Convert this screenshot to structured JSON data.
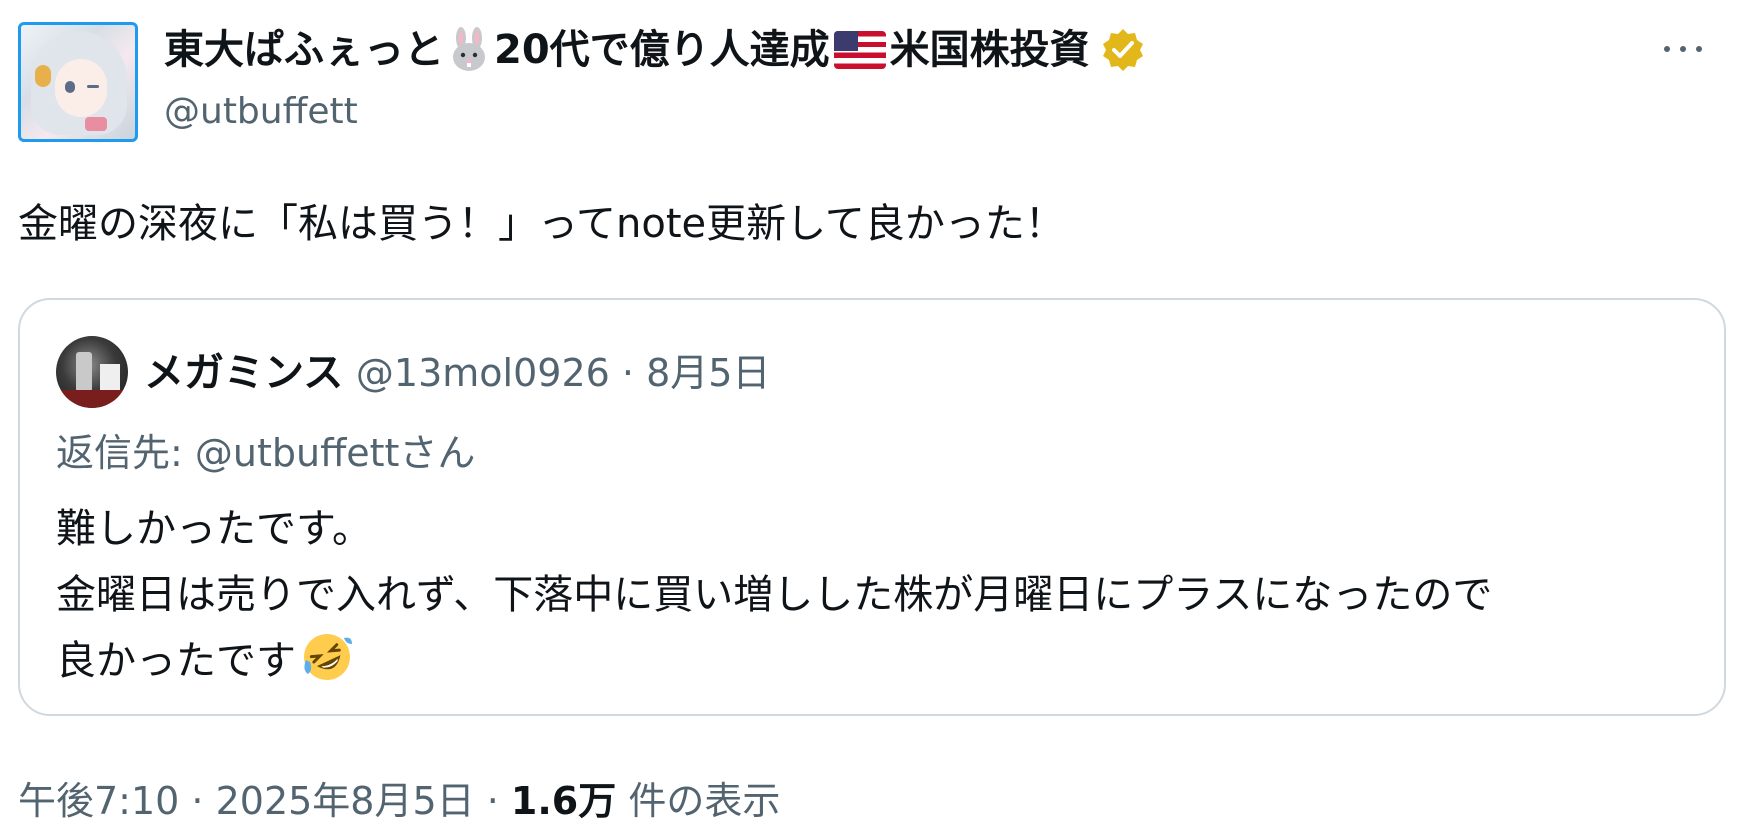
{
  "author": {
    "name_part1": "東大ぱふぇっと",
    "name_part2": "20代で億り人達成",
    "name_part3": "米国株投資",
    "name_icons": [
      "rabbit-icon",
      "us-flag-icon"
    ],
    "verified_icon": "verified-badge-icon",
    "handle": "@utbuffett"
  },
  "menu": {
    "icon": "more-icon"
  },
  "tweet": {
    "text": "金曜の深夜に「私は買う！」ってnote更新して良かった！"
  },
  "quote": {
    "name": "メガミンス",
    "handle": "@13mol0926",
    "separator": " · ",
    "date": "8月5日",
    "reply_to": "返信先: @utbuffettさん",
    "body_line1": "難しかったです。",
    "body_line2": "金曜日は売りで入れず、下落中に買い増しした株が月曜日にプラスになったので",
    "body_line3": "良かったです",
    "emoji": "rolling-on-floor-laughing-icon"
  },
  "meta": {
    "time": "午後7:10",
    "separator": " · ",
    "date": "2025年8月5日",
    "views_count": "1.6万",
    "views_label": " 件の表示"
  },
  "colors": {
    "text": "#0f1419",
    "secondary": "#536471",
    "border": "#cfd9de",
    "verified_gold": "#e2b719",
    "avatar_border": "#1d9bf0"
  }
}
